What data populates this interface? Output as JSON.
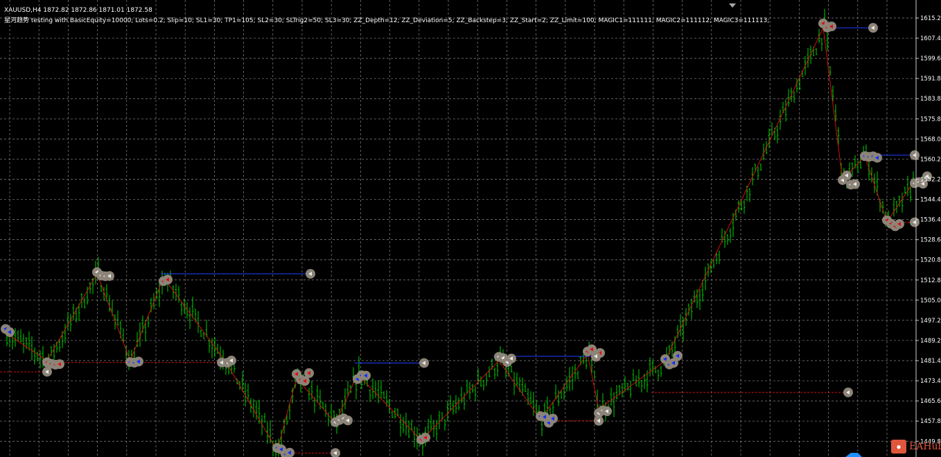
{
  "header": {
    "symbol_line": "XAUUSD,H4  1872.82 1872.86 1871.01 1872.58",
    "ea_line": "星河趋势 testing with BasicEquity=10000; Lots=0.2; Slip=10; SL1=30; TP1=105; SL2=30; SLTrig2=50; SL3=30; ZZ_Depth=12; ZZ_Deviation=5; ZZ_Backstep=3; ZZ_Start=2; ZZ_Limit=100; MAGIC1=111111; MAGIC2=111112; MAGIC3=111113;"
  },
  "price_axis": [
    "1615.20",
    "1607.40",
    "1599.60",
    "1591.80",
    "1583.80",
    "1575.80",
    "1568.00",
    "1560.20",
    "1552.20",
    "1544.40",
    "1536.40",
    "1528.60",
    "1520.80",
    "1512.80",
    "1505.00",
    "1497.20",
    "1489.20",
    "1481.40",
    "1473.40",
    "1465.60",
    "1457.80",
    "1449.80"
  ],
  "colors": {
    "grid": "#8a8a8a",
    "bars": "#00d000",
    "zigzag": "#d01010",
    "buy_line": "#2040ff",
    "sell_line": "#d01010",
    "marker": "#8c8478"
  },
  "zigzag": [
    {
      "bar": 2,
      "price": 1493.1
    },
    {
      "bar": 17,
      "price": 1482.3
    },
    {
      "bar": 35,
      "price": 1516.0
    },
    {
      "bar": 47,
      "price": 1482.3
    },
    {
      "bar": 59,
      "price": 1514.6
    },
    {
      "bar": 82,
      "price": 1481.0
    },
    {
      "bar": 100,
      "price": 1447.4
    },
    {
      "bar": 107,
      "price": 1475.6
    },
    {
      "bar": 121,
      "price": 1458.1
    },
    {
      "bar": 129,
      "price": 1477.0
    },
    {
      "bar": 152,
      "price": 1451.4
    },
    {
      "bar": 180,
      "price": 1482.3
    },
    {
      "bar": 195,
      "price": 1459.5
    },
    {
      "bar": 212,
      "price": 1485.0
    },
    {
      "bar": 216,
      "price": 1463.5
    },
    {
      "bar": 240,
      "price": 1482.3
    },
    {
      "bar": 297,
      "price": 1611.4
    },
    {
      "bar": 304,
      "price": 1552.3
    },
    {
      "bar": 312,
      "price": 1561.7
    },
    {
      "bar": 320,
      "price": 1536.1
    },
    {
      "bar": 330,
      "price": 1552.3
    }
  ],
  "order_lines": [
    {
      "type": "buy",
      "from": 58,
      "to": 112,
      "price": 1516.0
    },
    {
      "type": "buy",
      "from": 128,
      "to": 153,
      "price": 1481.4
    },
    {
      "type": "buy",
      "from": 178,
      "to": 215,
      "price": 1484.0
    },
    {
      "type": "buy",
      "from": 297,
      "to": 315,
      "price": 1611.4
    },
    {
      "type": "buy",
      "from": 312,
      "to": 330,
      "price": 1562.0
    },
    {
      "type": "sell",
      "from": 235,
      "to": 306,
      "price": 1470.0
    },
    {
      "type": "sell",
      "from": 0,
      "to": 17,
      "price": 1478.0
    },
    {
      "type": "sell",
      "from": 17,
      "to": 80,
      "price": 1481.6
    },
    {
      "type": "sell",
      "from": 195,
      "to": 216,
      "price": 1459.0
    },
    {
      "type": "sell",
      "from": 100,
      "to": 121,
      "price": 1446.5
    },
    {
      "type": "sell",
      "from": 320,
      "to": 330,
      "price": 1536.0
    }
  ],
  "logo": "EAHub"
}
